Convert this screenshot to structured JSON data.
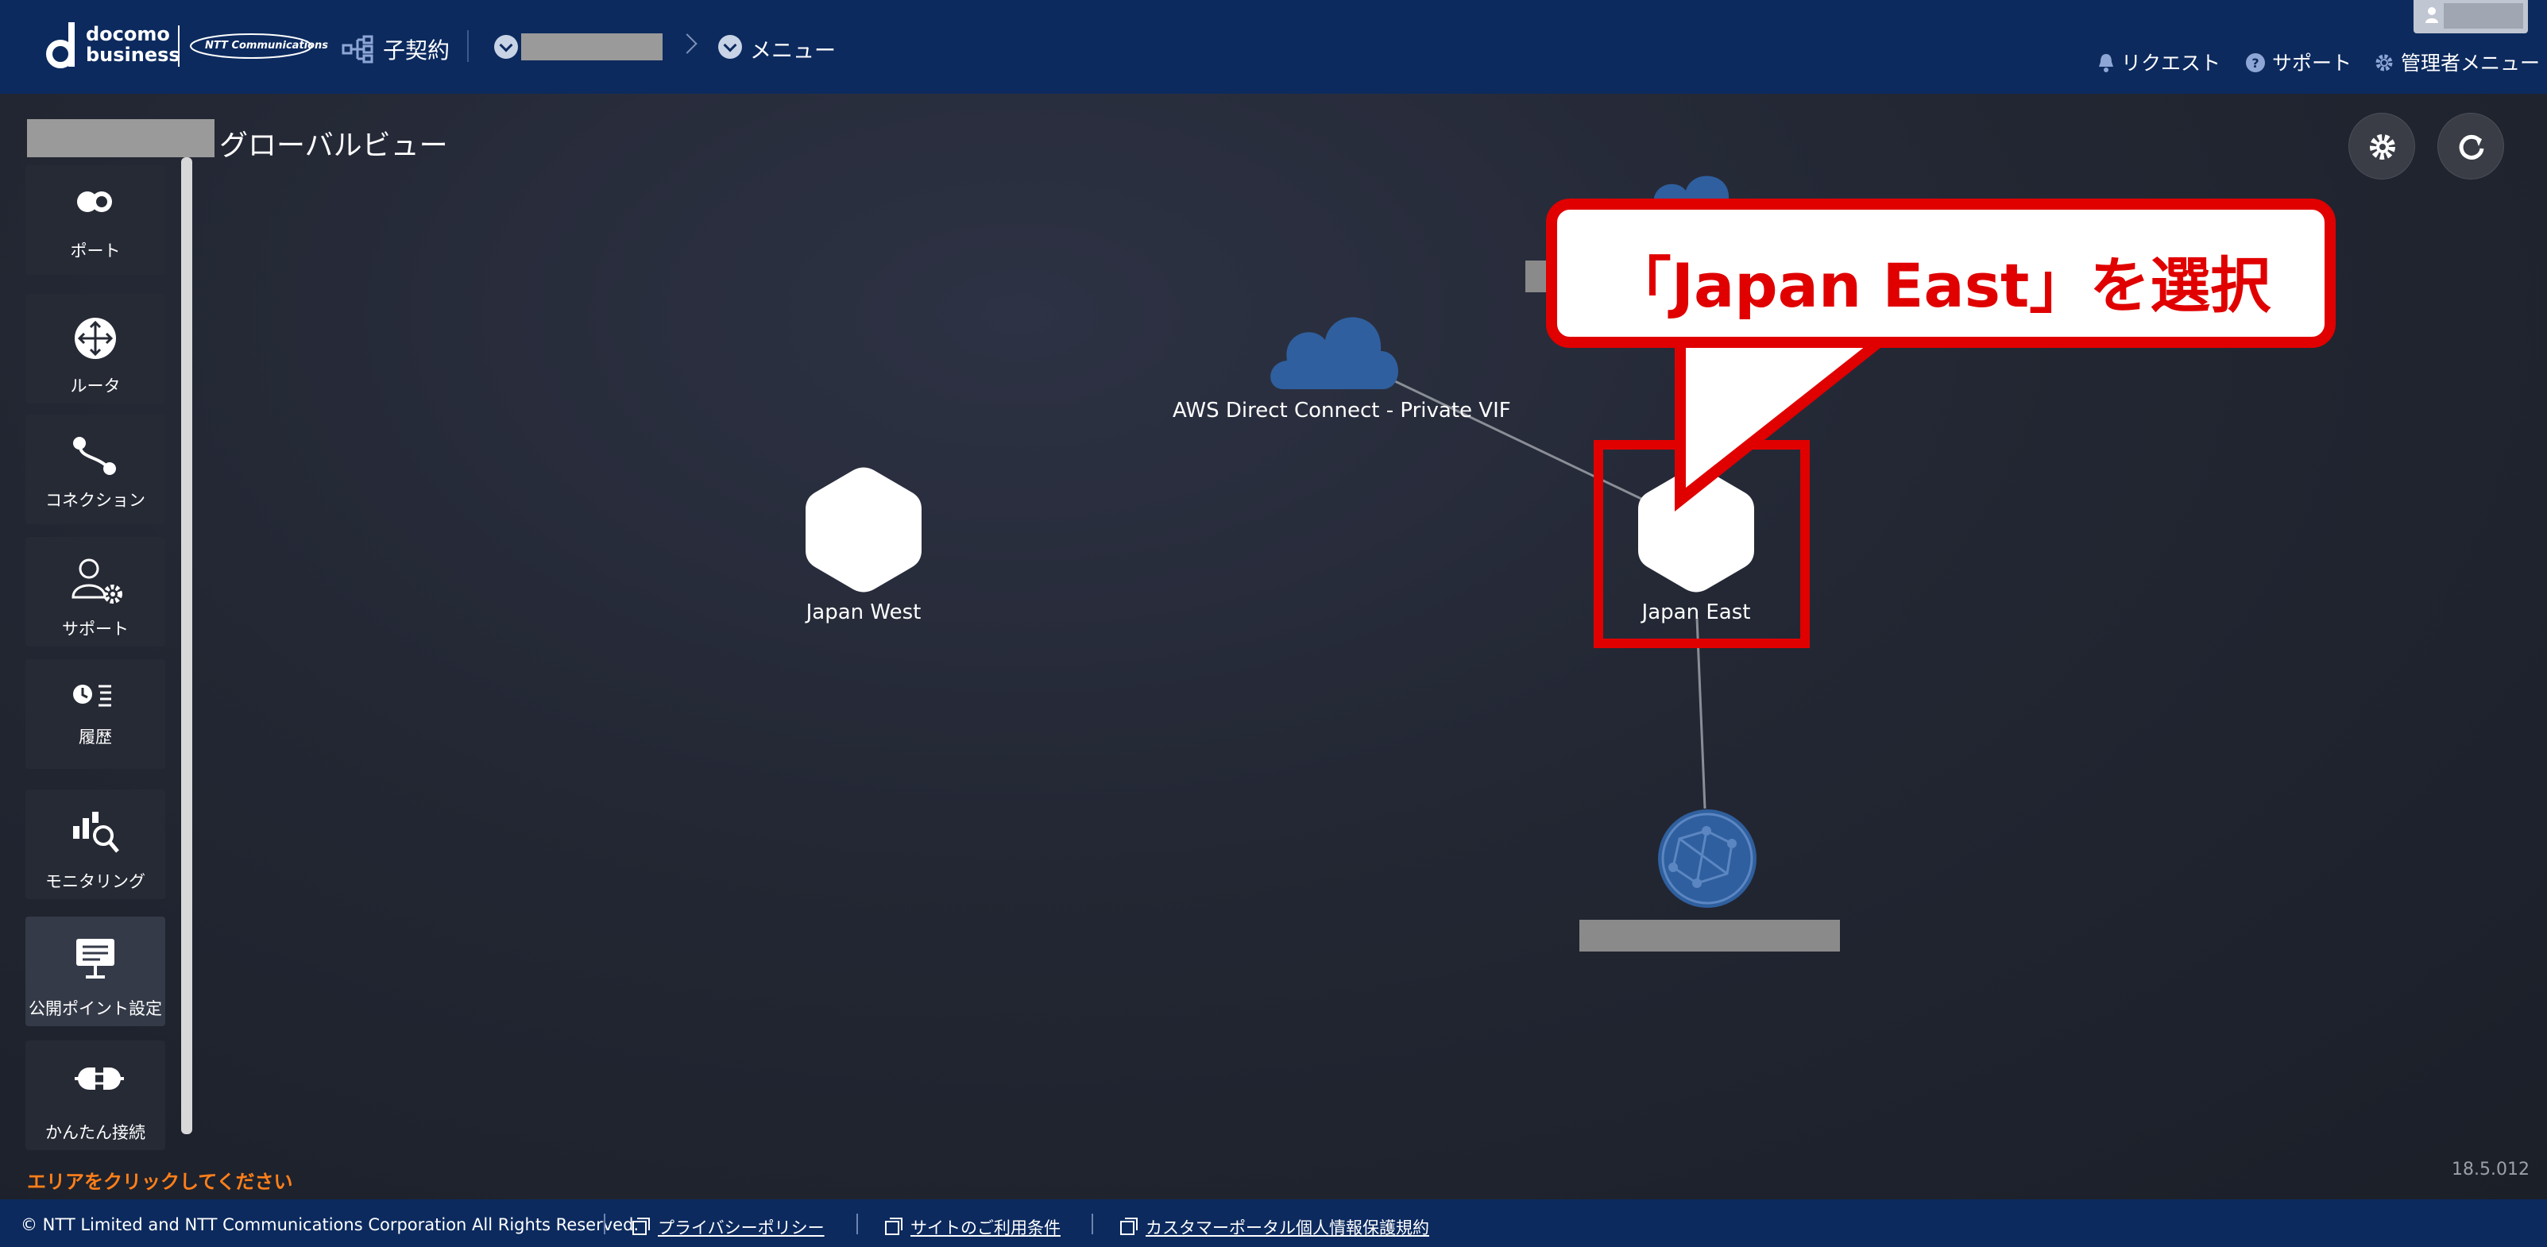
{
  "header": {
    "brand": {
      "line1": "docomo",
      "line2": "business",
      "partner": "NTT Communications"
    },
    "contract_label": "子契約",
    "breadcrumb_menu": "メニュー",
    "links": {
      "request": "リクエスト",
      "support": "サポート",
      "admin_menu": "管理者メニュー"
    }
  },
  "page": {
    "title": "グローバルビュー"
  },
  "sidebar": {
    "items": [
      {
        "label": "ポート",
        "icon": "port-icon"
      },
      {
        "label": "ルータ",
        "icon": "router-icon"
      },
      {
        "label": "コネクション",
        "icon": "connection-icon"
      },
      {
        "label": "サポート",
        "icon": "support-user-icon"
      },
      {
        "label": "履歴",
        "icon": "history-icon"
      },
      {
        "label": "モニタリング",
        "icon": "monitoring-icon"
      },
      {
        "label": "公開ポイント設定",
        "icon": "public-point-icon"
      },
      {
        "label": "かんたん接続",
        "icon": "easy-connect-icon"
      }
    ]
  },
  "canvas": {
    "nodes": {
      "aws_label": "AWS Direct Connect - Private VIF",
      "japan_west": "Japan West",
      "japan_east": "Japan East"
    },
    "hint": "エリアをクリックしてください",
    "version": "18.5.012"
  },
  "annotation": {
    "callout_text": "「Japan East」を選択",
    "color": "#e00000"
  },
  "footer": {
    "copyright": "© NTT Limited and NTT Communications Corporation All Rights Reserved.",
    "privacy": "プライバシーポリシー",
    "terms": "サイトのご利用条件",
    "customer_privacy": "カスタマーポータル個人情報保護規約"
  },
  "colors": {
    "header_bg": "#0c2a5e",
    "hint": "#ff7f1a",
    "cloud": "#2f5f9e"
  }
}
